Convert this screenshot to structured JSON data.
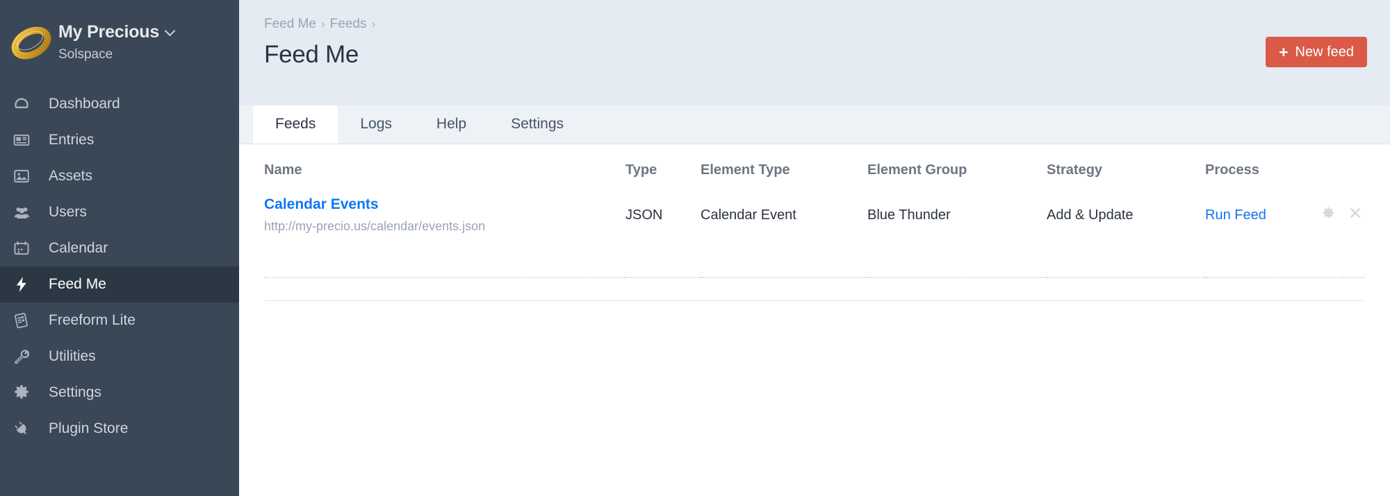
{
  "sidebar": {
    "brand": {
      "title": "My Precious",
      "subtitle": "Solspace",
      "logo_icon": "gold-ring-logo",
      "dropdown_icon": "chevron-down-icon"
    },
    "items": [
      {
        "label": "Dashboard",
        "icon": "gauge-icon",
        "active": false
      },
      {
        "label": "Entries",
        "icon": "newspaper-icon",
        "active": false
      },
      {
        "label": "Assets",
        "icon": "image-icon",
        "active": false
      },
      {
        "label": "Users",
        "icon": "users-icon",
        "active": false
      },
      {
        "label": "Calendar",
        "icon": "calendar-icon",
        "active": false
      },
      {
        "label": "Feed Me",
        "icon": "lightning-bolt-icon",
        "active": true
      },
      {
        "label": "Freeform Lite",
        "icon": "form-document-icon",
        "active": false
      },
      {
        "label": "Utilities",
        "icon": "wrench-icon",
        "active": false
      },
      {
        "label": "Settings",
        "icon": "gear-icon",
        "active": false
      },
      {
        "label": "Plugin Store",
        "icon": "plug-icon",
        "active": false
      }
    ]
  },
  "header": {
    "breadcrumb": [
      "Feed Me",
      "Feeds"
    ],
    "separator": "›",
    "title": "Feed Me",
    "new_feed_button": {
      "label": "New feed",
      "icon": "plus-icon",
      "color": "#da5a47"
    }
  },
  "tabs": [
    {
      "label": "Feeds",
      "active": true
    },
    {
      "label": "Logs",
      "active": false
    },
    {
      "label": "Help",
      "active": false
    },
    {
      "label": "Settings",
      "active": false
    }
  ],
  "table": {
    "columns": [
      "Name",
      "Type",
      "Element Type",
      "Element Group",
      "Strategy",
      "Process"
    ],
    "rows": [
      {
        "name": "Calendar Events",
        "url": "http://my-precio.us/calendar/events.json",
        "type": "JSON",
        "element_type": "Calendar Event",
        "element_group": "Blue Thunder",
        "strategy": "Add & Update",
        "process": "Run Feed",
        "actions": [
          "gear-icon",
          "close-icon"
        ]
      }
    ]
  },
  "colors": {
    "accent": "#da5a47",
    "link": "#1672ef",
    "sidebar_bg": "#3a4756",
    "sidebar_active_bg": "#2c3744",
    "header_bg": "#e5ebf2"
  }
}
